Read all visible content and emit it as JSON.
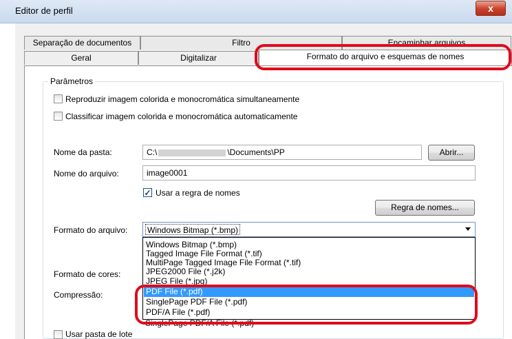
{
  "window": {
    "title": "Editor de perfil",
    "close_glyph": "x"
  },
  "tabs": {
    "back_row": [
      "Separação de documentos",
      "Filtro",
      "Encaminhar arquivos"
    ],
    "front_row": [
      "Geral",
      "Digitalizar",
      "Formato do arquivo e esquemas de nomes"
    ],
    "selected": "Formato do arquivo e esquemas de nomes"
  },
  "params": {
    "group_label": "Parâmetros",
    "check_simultaneous": "Reproduzir imagem colorida e monocromática simultaneamente",
    "check_auto_classify": "Classificar imagem colorida e monocromática automaticamente"
  },
  "folder": {
    "label": "Nome da pasta:",
    "value_start": "C:\\",
    "value_end": "\\Documents\\PP",
    "browse_button": "Abrir..."
  },
  "file_name": {
    "label": "Nome do arquivo:",
    "value": "image0001",
    "naming_rule_check": "Usar a regra de nomes",
    "naming_rule_checked": true,
    "naming_rule_button": "Regra de nomes..."
  },
  "file_format": {
    "label": "Formato do arquivo:",
    "selected": "Windows Bitmap (*.bmp)",
    "options": [
      "Windows Bitmap (*.bmp)",
      "Tagged Image File Format (*.tif)",
      "MultiPage Tagged Image File Format (*.tif)",
      "JPEG2000 File (*.j2k)",
      "JPEG File (*.jpg)",
      "PDF File (*.pdf)",
      "SinglePage PDF File (*.pdf)",
      "PDF/A File (*.pdf)",
      "SinglePage PDF/A File (*.pdf)"
    ],
    "highlighted_option": "PDF File (*.pdf)"
  },
  "color_format": {
    "label": "Formato de cores:"
  },
  "compression": {
    "label": "Compressão:"
  },
  "batch_folder": {
    "label": "Usar pasta de lote"
  },
  "colors": {
    "highlight": "#e00b1b",
    "selection": "#3399ff"
  }
}
